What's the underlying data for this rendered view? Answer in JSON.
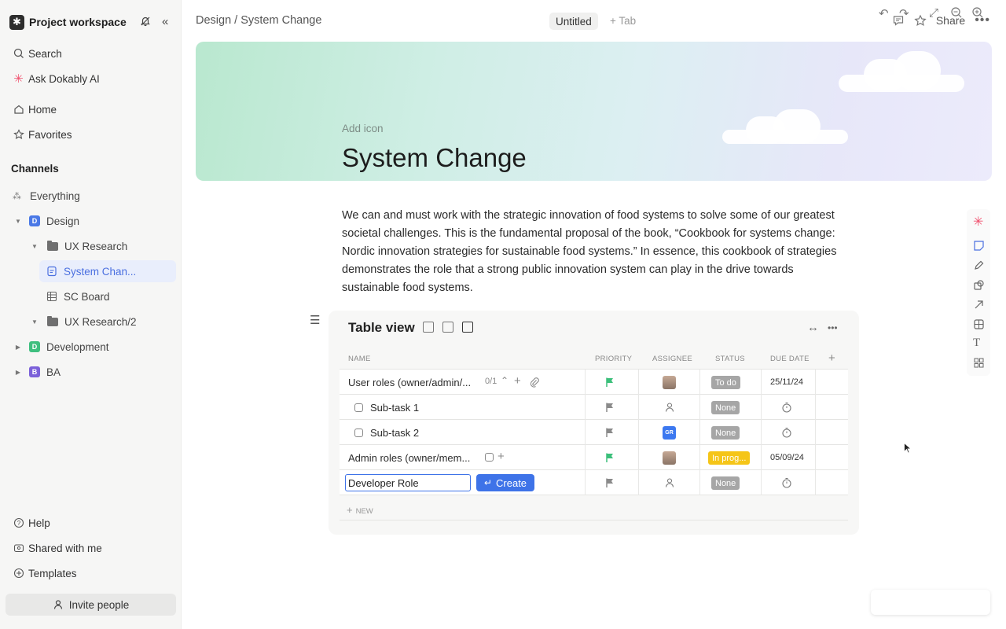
{
  "sidebar": {
    "workspace_title": "Project workspace",
    "nav": {
      "search": "Search",
      "ask_ai": "Ask Dokably AI",
      "home": "Home",
      "favorites": "Favorites"
    },
    "channels_label": "Channels",
    "tree": {
      "everything": "Everything",
      "design": "Design",
      "design_letter": "D",
      "ux_research": "UX Research",
      "system_change": "System Chan...",
      "sc_board": "SC Board",
      "ux_research2": "UX Research/2",
      "development": "Development",
      "development_letter": "D",
      "ba": "BA",
      "ba_letter": "B"
    },
    "footer": {
      "help": "Help",
      "shared": "Shared with me",
      "templates": "Templates",
      "invite": "Invite people"
    },
    "colors": {
      "design_badge": "#4a78e6",
      "development_badge": "#3fbf7f",
      "ba_badge": "#7b61d9"
    }
  },
  "topbar": {
    "breadcrumb": "Design / System Change",
    "tab_untitled": "Untitled",
    "tab_add": "+ Tab",
    "share": "Share"
  },
  "page": {
    "add_icon": "Add icon",
    "title": "System Change",
    "body": "We can and must work with the strategic innovation of food systems to solve some of our greatest societal challenges. This is the fundamental proposal of the book, “Cookbook for systems change: Nordic innovation strategies for sustainable food systems.” In essence, this cookbook of strategies  demonstrates the role that a strong public innovation system can play in the drive towards sustainable food systems."
  },
  "table": {
    "title": "Table view",
    "columns": {
      "name": "NAME",
      "priority": "PRIORITY",
      "assignee": "ASSIGNEE",
      "status": "STATUS",
      "due": "DUE DATE"
    },
    "rows": [
      {
        "name": "User roles (owner/admin/...",
        "meta": "0/1",
        "status": "To do",
        "due": "25/11/24"
      },
      {
        "name": "Sub-task 1",
        "status": "None"
      },
      {
        "name": "Sub-task 2",
        "assignee_initials": "GR",
        "status": "None"
      },
      {
        "name": "Admin roles (owner/mem...",
        "status": "In prog...",
        "due": "05/09/24"
      },
      {
        "name": "",
        "status": "None"
      }
    ],
    "editing_value": "Developer Role",
    "create_label": "Create",
    "new_label": "NEW",
    "colors": {
      "flag_green": "#3bbf7a",
      "flag_gray": "#8a8a8a",
      "status_todo": "#a6a6a6",
      "status_none": "#a6a6a6",
      "status_progress": "#f5c518",
      "accent": "#3e73e8"
    }
  }
}
